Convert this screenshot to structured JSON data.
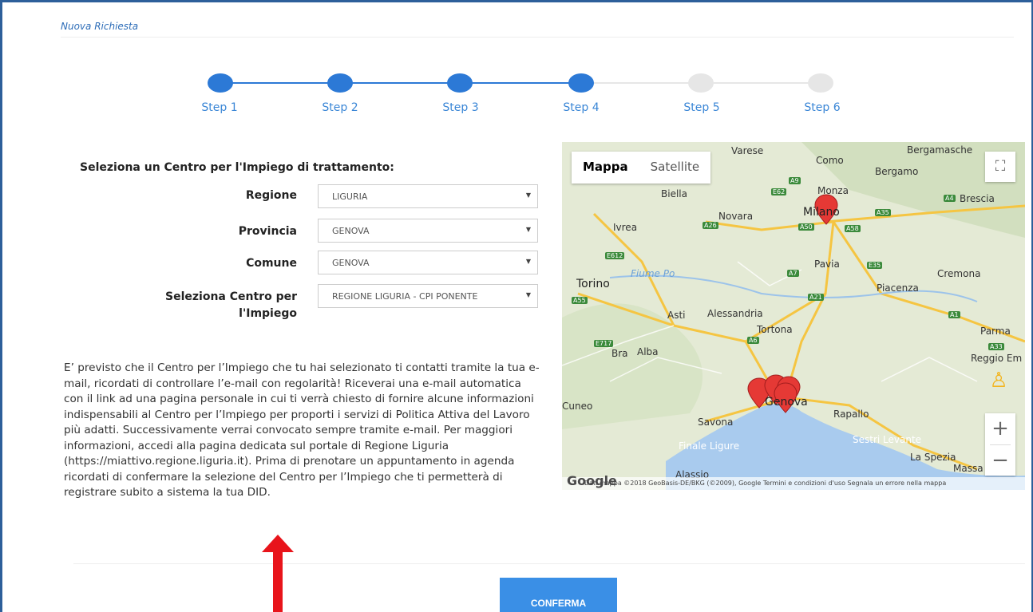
{
  "breadcrumb": "Nuova Richiesta",
  "steps": [
    {
      "label": "Step 1",
      "done": true
    },
    {
      "label": "Step 2",
      "done": true
    },
    {
      "label": "Step 3",
      "done": true
    },
    {
      "label": "Step 4",
      "done": true
    },
    {
      "label": "Step 5",
      "done": false
    },
    {
      "label": "Step 6",
      "done": false
    }
  ],
  "form": {
    "title": "Seleziona un Centro per l'Impiego di trattamento:",
    "fields": [
      {
        "label": "Regione",
        "value": "LIGURIA"
      },
      {
        "label": "Provincia",
        "value": "GENOVA"
      },
      {
        "label": "Comune",
        "value": "GENOVA"
      },
      {
        "label": "Seleziona Centro per l'Impiego",
        "value": "REGIONE LIGURIA - CPI PONENTE"
      }
    ]
  },
  "info": "E’ previsto che il Centro per l’Impiego che tu hai selezionato ti contatti tramite la tua e-mail, ricordati di controllare l’e-mail con regolarità! Riceverai una e-mail automatica con il link ad una pagina personale in cui ti verrà chiesto di fornire alcune informazioni indispensabili al Centro per l’Impiego per proporti i servizi di Politica Attiva del Lavoro più adatti. Successivamente verrai convocato sempre tramite e-mail. Per maggiori informazioni, accedi alla pagina dedicata sul portale di Regione Liguria (https://miattivo.regione.liguria.it). Prima di prenotare un appuntamento in agenda ricordati di confermare la selezione del Centro per l’Impiego che ti permetterà di registrare subito a sistema la tua DID.",
  "map": {
    "type_map": "Mappa",
    "type_satellite": "Satellite",
    "attribution": "Dati mappa ©2018 GeoBasis-DE/BKG (©2009), Google   Termini e condizioni d'uso   Segnala un errore nella mappa",
    "google": "Google",
    "cities": [
      "Varese",
      "Como",
      "Bergamasche",
      "Bergamo",
      "Biella",
      "Monza",
      "Brescia",
      "Novara",
      "Milano",
      "Ivrea",
      "Pavia",
      "Cremona",
      "Torino",
      "Fiume Po",
      "Piacenza",
      "Asti",
      "Alessandria",
      "Tortona",
      "Parma",
      "Bra",
      "Alba",
      "Reggio Em",
      "Cuneo",
      "Genova",
      "Rapallo",
      "Savona",
      "Sestri Levante",
      "Finale Ligure",
      "La Spezia",
      "Alassio",
      "Massa"
    ],
    "roads": [
      "A9",
      "E62",
      "A4",
      "A26",
      "A50",
      "A58",
      "A35",
      "E612",
      "A7",
      "E35",
      "A21",
      "A55",
      "E717",
      "A6",
      "A1",
      "A33"
    ]
  },
  "confirm_label": "CONFERMA",
  "colors": {
    "primary": "#2c79d6",
    "button": "#3a8fe6",
    "arrow": "#e8141b"
  }
}
